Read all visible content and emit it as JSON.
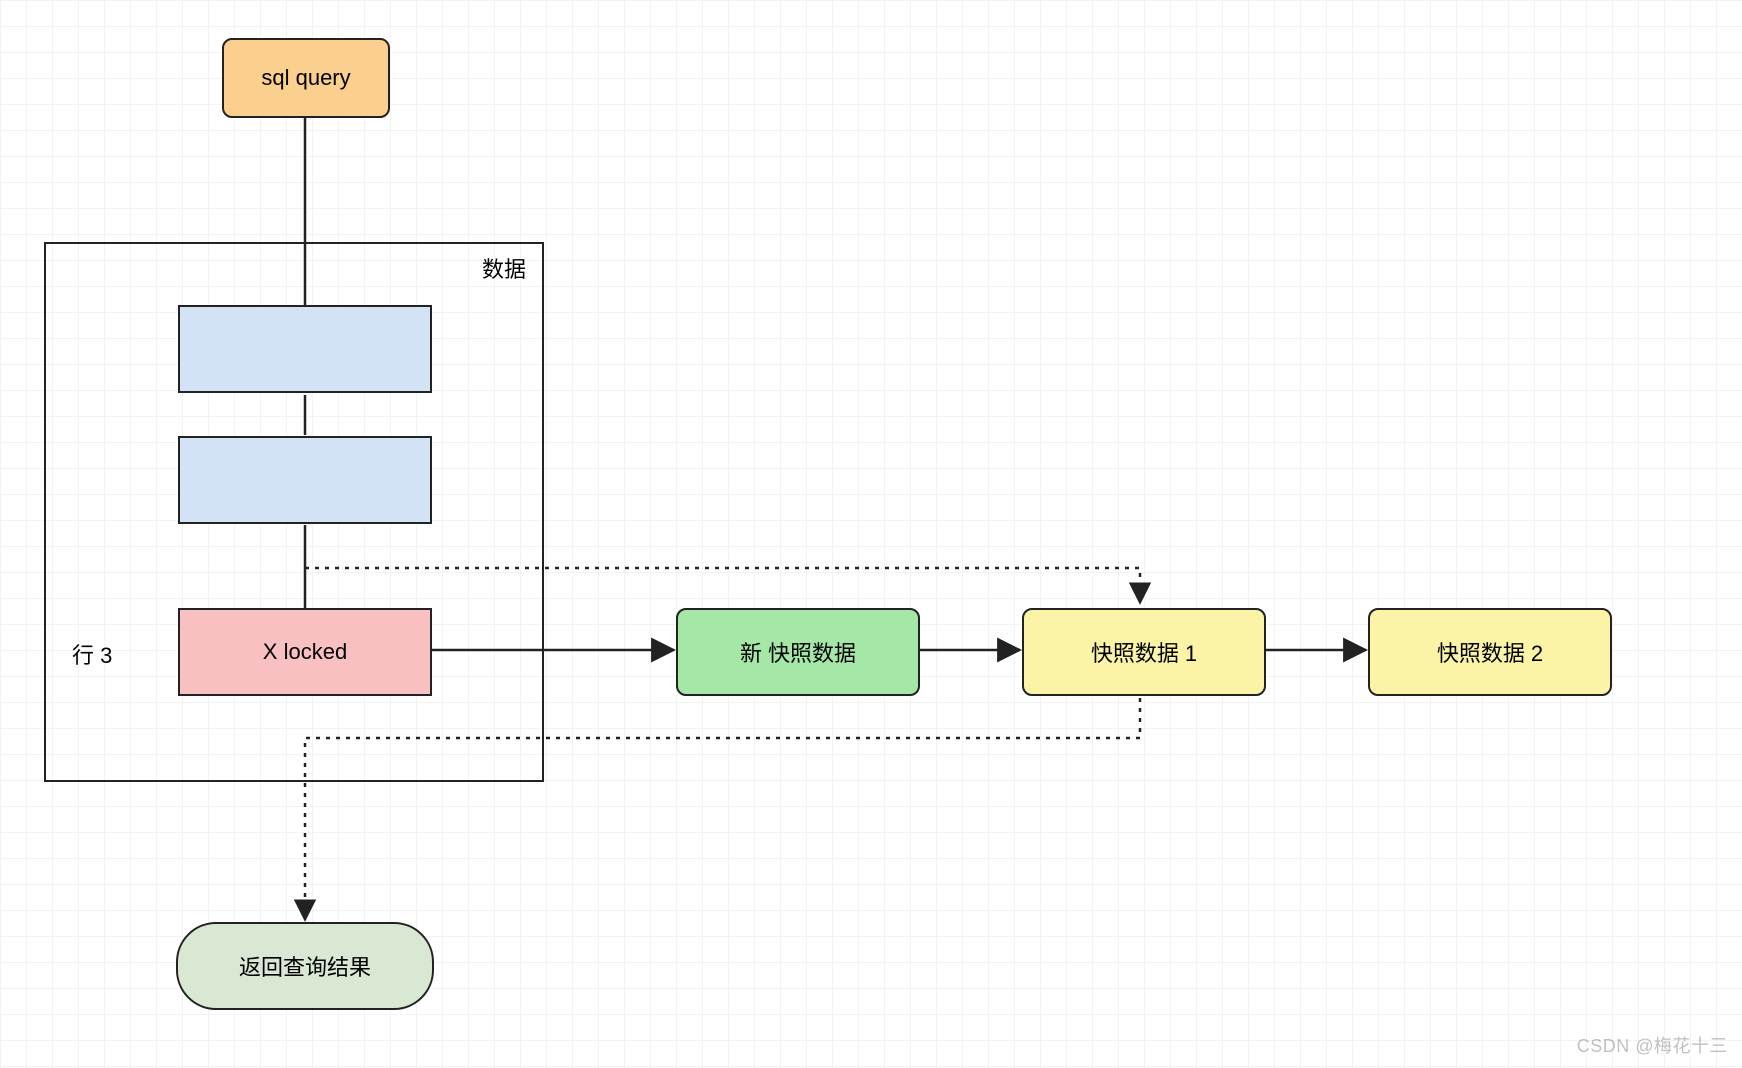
{
  "nodes": {
    "sql_query": "sql query",
    "row3_label": "行 3",
    "x_locked": "X locked",
    "new_snapshot": "新 快照数据",
    "snapshot1": "快照数据 1",
    "snapshot2": "快照数据 2",
    "return_result": "返回查询结果"
  },
  "container": {
    "title": "数据"
  },
  "watermark": "CSDN @梅花十三"
}
